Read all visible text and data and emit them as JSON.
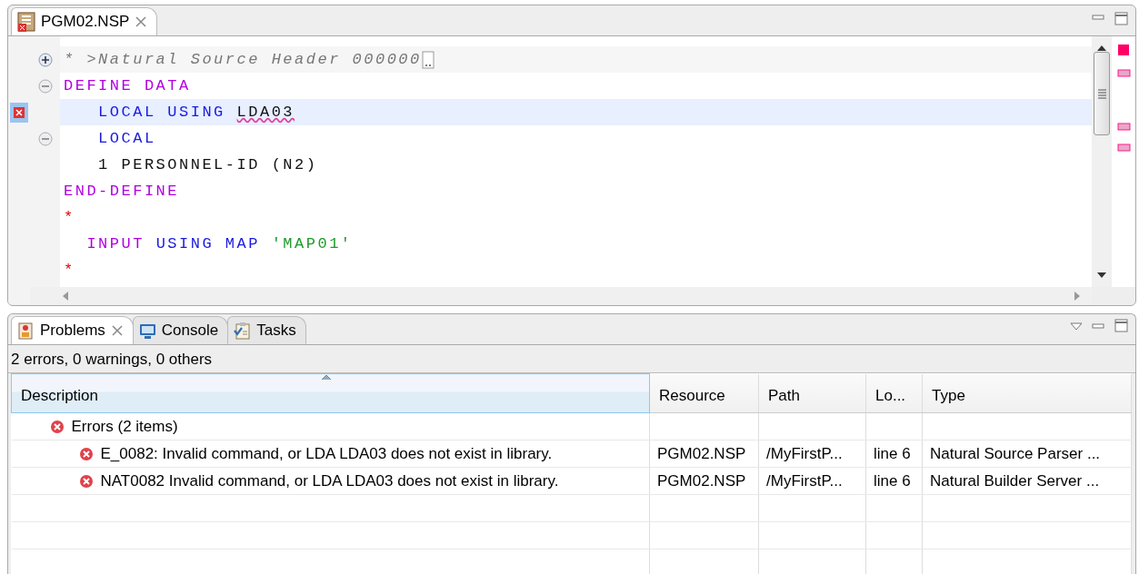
{
  "editor": {
    "tabs": [
      {
        "title": "PGM02.NSP",
        "selected": true,
        "closable": true
      }
    ],
    "lines": [
      {
        "foldable": true,
        "expanded": false,
        "error": false,
        "current": false,
        "header": true,
        "tokens": [
          {
            "text": "* >Natural Source Header 000000",
            "kind": "header"
          }
        ]
      },
      {
        "foldable": true,
        "expanded": true,
        "error": false,
        "current": false,
        "header": false,
        "tokens": [
          {
            "text": "DEFINE DATA",
            "kind": "keyword"
          }
        ]
      },
      {
        "foldable": false,
        "error": true,
        "current": true,
        "header": false,
        "tokens": [
          {
            "text": "   LOCAL USING ",
            "kind": "statement"
          },
          {
            "text": "LDA03",
            "kind": "problem"
          }
        ]
      },
      {
        "foldable": true,
        "expanded": true,
        "error": false,
        "current": false,
        "header": false,
        "tokens": [
          {
            "text": "   LOCAL",
            "kind": "statement"
          }
        ]
      },
      {
        "foldable": false,
        "error": false,
        "current": false,
        "header": false,
        "tokens": [
          {
            "text": "   1 PERSONNEL-ID (N2)",
            "kind": "plain"
          }
        ]
      },
      {
        "foldable": false,
        "error": false,
        "current": false,
        "header": false,
        "tokens": [
          {
            "text": "END-DEFINE",
            "kind": "keyword"
          }
        ]
      },
      {
        "foldable": false,
        "error": false,
        "current": false,
        "header": false,
        "tokens": [
          {
            "text": "*",
            "kind": "comment"
          }
        ]
      },
      {
        "foldable": false,
        "error": false,
        "current": false,
        "header": false,
        "tokens": [
          {
            "text": "  INPUT ",
            "kind": "keyword"
          },
          {
            "text": "USING MAP ",
            "kind": "statement"
          },
          {
            "text": "'MAP01'",
            "kind": "string"
          }
        ]
      },
      {
        "foldable": false,
        "error": false,
        "current": false,
        "header": false,
        "tokens": [
          {
            "text": "*",
            "kind": "comment"
          }
        ]
      }
    ]
  },
  "problems": {
    "tabs": [
      {
        "title": "Problems",
        "selected": true,
        "closable": true,
        "kind": "problems"
      },
      {
        "title": "Console",
        "selected": false,
        "closable": false,
        "kind": "console"
      },
      {
        "title": "Tasks",
        "selected": false,
        "closable": false,
        "kind": "tasks"
      }
    ],
    "summary": "2 errors, 0 warnings, 0 others",
    "columns": [
      "Description",
      "Resource",
      "Path",
      "Lo...",
      "Type"
    ],
    "rows": [
      {
        "description": "Errors (2 items)",
        "children": [
          {
            "description": "E_0082: Invalid command, or LDA LDA03 does not exist in library.",
            "resource": "PGM02.NSP",
            "path": "/MyFirstP...",
            "location": "line 6",
            "type": "Natural Source Parser ..."
          },
          {
            "description": "NAT0082 Invalid command, or LDA LDA03 does not exist in library.",
            "resource": "PGM02.NSP",
            "path": "/MyFirstP...",
            "location": "line 6",
            "type": "Natural Builder Server ..."
          }
        ]
      }
    ]
  }
}
